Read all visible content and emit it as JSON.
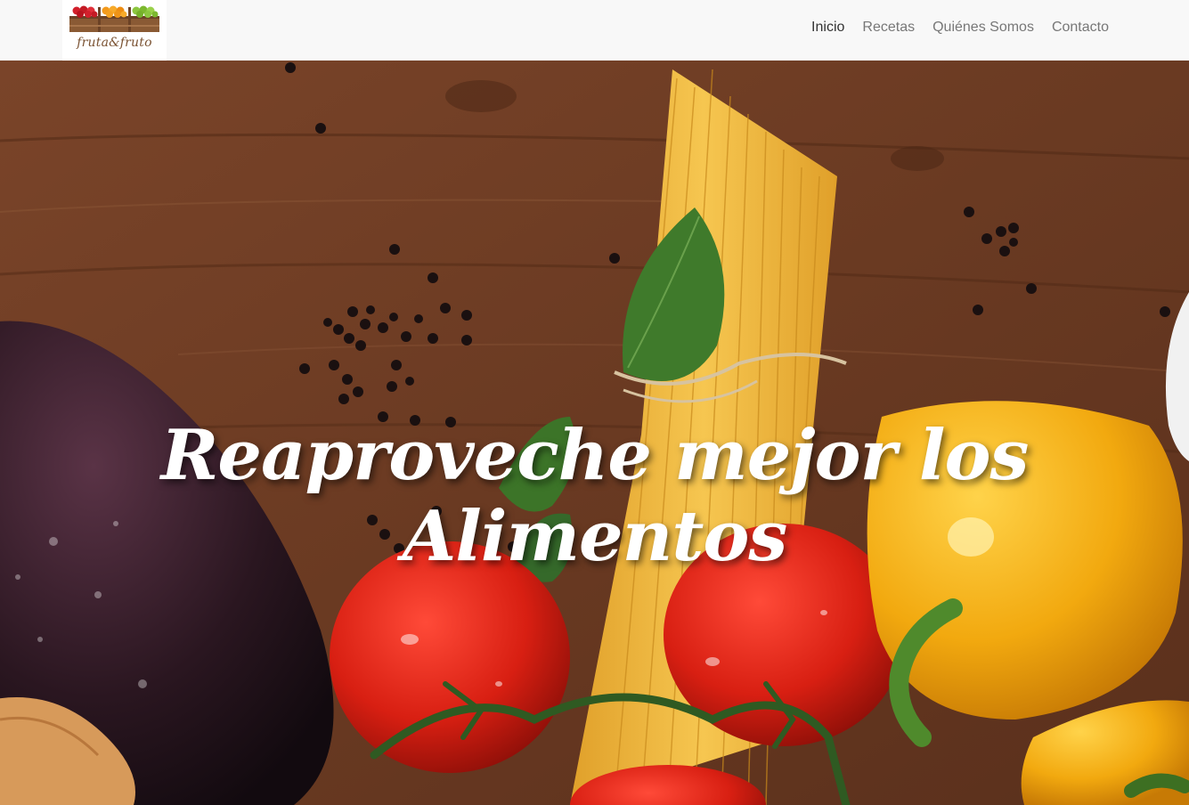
{
  "brand": {
    "logo_text": "fruta&fruto",
    "logo_icon": "fruit-crate-logo"
  },
  "nav": {
    "items": [
      {
        "label": "Inicio",
        "active": true
      },
      {
        "label": "Recetas",
        "active": false
      },
      {
        "label": "Quiénes Somos",
        "active": false
      },
      {
        "label": "Contacto",
        "active": false
      }
    ]
  },
  "hero": {
    "title": "Reaproveche mejor los Alimentos",
    "background_image": "hero-food-photo"
  },
  "colors": {
    "nav_bg": "#f8f8f8",
    "nav_link": "#777777",
    "nav_link_active": "#333333",
    "wood": "#6e3e24",
    "tomato": "#d81f12",
    "pepper": "#f2a90f",
    "pasta": "#f0b43a",
    "basil": "#3f7a2b",
    "eggplant": "#2a1620"
  }
}
